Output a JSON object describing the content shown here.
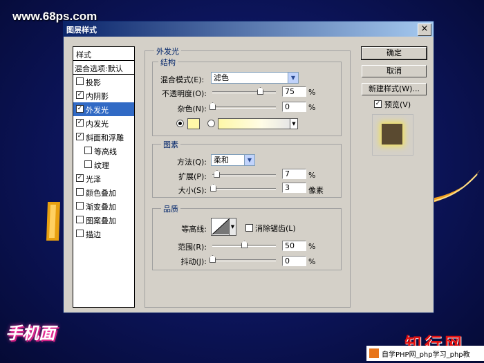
{
  "site": {
    "url": "www.68ps.com"
  },
  "dialog": {
    "title": "图层样式",
    "close_glyph": "×"
  },
  "left_panel": {
    "header": "样式",
    "blend_options": "混合选项:默认",
    "items": [
      {
        "label": "投影",
        "checked": false
      },
      {
        "label": "内阴影",
        "checked": true
      },
      {
        "label": "外发光",
        "checked": true,
        "selected": true
      },
      {
        "label": "内发光",
        "checked": true
      },
      {
        "label": "斜面和浮雕",
        "checked": true
      },
      {
        "label": "等高线",
        "checked": false,
        "indent": true
      },
      {
        "label": "纹理",
        "checked": false,
        "indent": true
      },
      {
        "label": "光泽",
        "checked": true
      },
      {
        "label": "颜色叠加",
        "checked": false
      },
      {
        "label": "渐变叠加",
        "checked": false
      },
      {
        "label": "图案叠加",
        "checked": false
      },
      {
        "label": "描边",
        "checked": false
      }
    ]
  },
  "outer_glow": {
    "title": "外发光",
    "structure": {
      "title": "结构",
      "blend_mode_label": "混合模式(E):",
      "blend_mode_value": "滤色",
      "opacity_label": "不透明度(O):",
      "opacity_value": "75",
      "opacity_level": 0.75,
      "noise_label": "杂色(N):",
      "noise_value": "0",
      "noise_level": 0,
      "percent": "%",
      "color_swatch": "#fef7a8"
    },
    "elements": {
      "title": "图素",
      "technique_label": "方法(Q):",
      "technique_value": "柔和",
      "spread_label": "扩展(P):",
      "spread_value": "7",
      "spread_level": 0.07,
      "size_label": "大小(S):",
      "size_value": "3",
      "size_level": 0.012,
      "pixels_unit": "像素",
      "percent": "%"
    },
    "quality": {
      "title": "品质",
      "contour_label": "等高线:",
      "anti_alias_label": "消除锯齿(L)",
      "anti_alias_checked": false,
      "range_label": "范围(R):",
      "range_value": "50",
      "range_level": 0.5,
      "jitter_label": "抖动(J):",
      "jitter_value": "0",
      "jitter_level": 0,
      "percent": "%"
    }
  },
  "buttons": {
    "ok": "确定",
    "cancel": "取消",
    "new_style": "新建样式(W)...",
    "preview_label": "预览(V)",
    "preview_checked": true
  },
  "watermark": {
    "logo_text": "手机面",
    "brand": "知行网",
    "footer": "自学PHP网_php学习_php教"
  },
  "colors": {
    "accent": "#316ac5",
    "titlebar": "#0a246a",
    "brand_red": "#e01010"
  }
}
